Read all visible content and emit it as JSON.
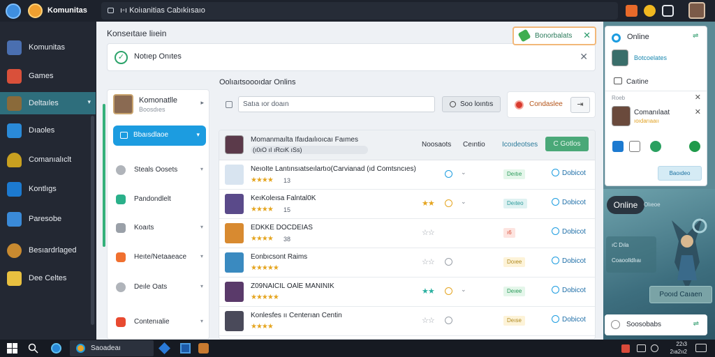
{
  "app": {
    "brand": "Komunitas",
    "address": "ı◦ı Koiıanitias Cabıkiısaıo"
  },
  "sidebar": {
    "items": [
      {
        "label": "Komunitas",
        "icon": "warrior-avatar-icon",
        "color": "#4a6fb0"
      },
      {
        "label": "Games",
        "icon": "gamepad-icon",
        "color": "#d9503a"
      },
      {
        "label": "Deltaıles",
        "icon": "hero-avatar-icon",
        "color": "#8a6a3a",
        "active": true
      },
      {
        "label": "Dıaoles",
        "icon": "cube-icon",
        "color": "#2a8ad8"
      },
      {
        "label": "Comanıalıclt",
        "icon": "shield-icon",
        "color": "#c8a020"
      },
      {
        "label": "Kontlıgs",
        "icon": "chat-icon",
        "color": "#1c7ad0"
      },
      {
        "label": "Paresobe",
        "icon": "puzzle-icon",
        "color": "#3a8ad8"
      },
      {
        "label": "Besıardrlaged",
        "icon": "badge-icon",
        "color": "#c88a30"
      },
      {
        "label": "Dee Celtes",
        "icon": "note-icon",
        "color": "#e8c040"
      }
    ]
  },
  "main": {
    "page_title": "Konseıtaıe liıein",
    "notice": {
      "text": "Notıep Onıtes"
    },
    "toast": {
      "text": "Bonorbalats"
    },
    "left_panel": {
      "user_name": "Komonatlle",
      "user_sub": "Boosdıes",
      "primary_button": "Bbaısdlaoe",
      "items": [
        {
          "label": "Steals Oosets",
          "color": "#b0b4ba"
        },
        {
          "label": "Pandondlelt",
          "color": "#2ab08a"
        },
        {
          "label": "Koaıts",
          "color": "#9aa0a8"
        },
        {
          "label": "Heıte/Netaaeace",
          "color": "#f07030"
        },
        {
          "label": "Deıle Oats",
          "color": "#b0b4ba"
        },
        {
          "label": "Contenıalie",
          "color": "#e84a30"
        }
      ]
    },
    "section_title": "Oolıaıtsoooıdar Onlins",
    "toolbar": {
      "search_placeholder": "Satıa ıor doaın",
      "search_button": "Soo loıntıs",
      "status_label": "Condaslee"
    },
    "list": {
      "header": {
        "title": "Momanmaılta Ifaıdaılıoıcaı Faımes",
        "subtitle": "(ı0ıO ıI ıRcıK ıSs)",
        "columns": [
          "Noosaots",
          "Ceıntio",
          "Icoıdeotses"
        ],
        "button": "C Gotlos"
      },
      "rows": [
        {
          "title": "NeıoIte Lantınsıatseılartıo(Carvianad (ıd Comtsncıes)",
          "stars": "★★★★",
          "num": "13",
          "rating": "",
          "rating_color": "#e5a520",
          "badge": "Deıtıe",
          "badge_bg": "#e4f6ea",
          "badge_fg": "#2a9a5a",
          "action": "Dobicot",
          "avatar_color": "#d8e4f0",
          "info_color": "#1c9ce0"
        },
        {
          "title": "KeıKoleısa Falntal0K",
          "stars": "★★★★",
          "num": "15",
          "rating": "★★",
          "rating_color": "#e5a520",
          "badge": "Deıteo",
          "badge_bg": "#dff2f2",
          "badge_fg": "#2a9a9a",
          "action": "Dobicot",
          "avatar_color": "#5a4a8a",
          "info_color": "#e5a520"
        },
        {
          "title": "EDKKE DOCDEIAS",
          "stars": "★★★★",
          "num": "38",
          "rating": "☆☆",
          "rating_color": "#9aa0a8",
          "badge": "ı6",
          "badge_bg": "#fde4e0",
          "badge_fg": "#d8503a",
          "action": "Dobicot",
          "avatar_color": "#d88a30",
          "info_color": ""
        },
        {
          "title": "Eonbıcsont Raims",
          "stars": "★★★★★",
          "num": "",
          "rating": "☆☆",
          "rating_color": "#9aa0a8",
          "badge": "Doıee",
          "badge_bg": "#fdf3d8",
          "badge_fg": "#b08a20",
          "action": "Dobicot",
          "avatar_color": "#3a8ac0",
          "info_color": "#9aa0a8"
        },
        {
          "title": "Z09NAICIL OAlE MANINIK",
          "stars": "★★★★★",
          "num": "",
          "rating": "★★",
          "rating_color": "#2ab0a0",
          "badge": "Deıee",
          "badge_bg": "#e4f6ea",
          "badge_fg": "#2a9a5a",
          "action": "Dobicot",
          "avatar_color": "#5a3a6a",
          "info_color": "#e5a520"
        },
        {
          "title": "Konlesfes ıı Centerıan Centin",
          "stars": "★★★★",
          "num": "",
          "rating": "☆☆",
          "rating_color": "#9aa0a8",
          "badge": "Deıse",
          "badge_bg": "#fdf3d8",
          "badge_fg": "#b08a20",
          "action": "Dobicot",
          "avatar_color": "#4a4a5a",
          "info_color": "#9aa0a8"
        }
      ]
    }
  },
  "right": {
    "status": "Online",
    "user_name": "Botcoelates",
    "online_label": "Caıtine",
    "small_label": "Roeb",
    "friend_name": "Comanılaat",
    "friend_sub": "ıoıdarıaaıı",
    "send_button": "Baoıdeo",
    "pill": "Online",
    "pill_sub": "Olıeoe",
    "card_line1": "ıC Dıla",
    "card_line2": "Coaoolldlıaı",
    "action_button": "Pooıd Caıaen",
    "footer_label": "Soosobabs"
  },
  "taskbar": {
    "active_app": "Saoadeaı",
    "time": "22ı3",
    "date": "2ıa2ıı2"
  }
}
